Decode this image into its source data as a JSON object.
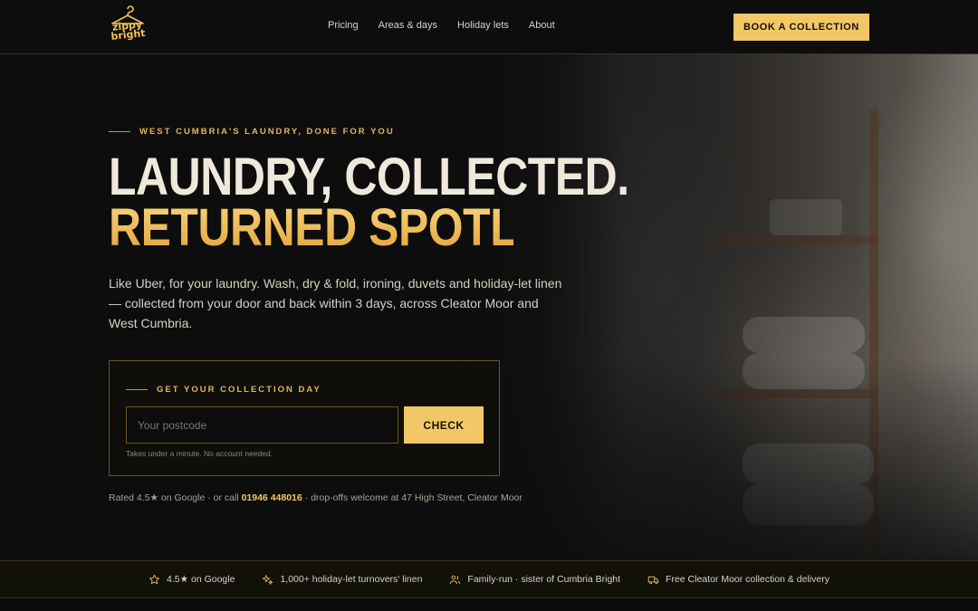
{
  "brand": {
    "logo_text": "zippy bright",
    "accent": "#f3c766",
    "background": "#0d0d0d"
  },
  "nav": {
    "items": [
      "Pricing",
      "Areas & days",
      "Holiday lets",
      "About"
    ]
  },
  "header": {
    "cta_label": "BOOK A COLLECTION"
  },
  "hero": {
    "eyebrow": "WEST CUMBRIA'S LAUNDRY, DONE FOR YOU",
    "headline_line1": "LAUNDRY, COLLECTED.",
    "headline_line2": "RETURNED SPOTLESS.",
    "lead": "Like Uber, for your laundry. Wash, dry & fold, ironing, duvets and holiday-let linen — collected from your door and back within 3 days, across Cleator Moor and West Cumbria."
  },
  "form": {
    "eyebrow": "GET YOUR COLLECTION DAY",
    "postcode_placeholder": "Your postcode",
    "postcode_value": "",
    "button_label": "CHECK",
    "hint": "Takes under a minute. No account needed."
  },
  "rated": {
    "prefix": "Rated 4.5★ on Google · or call ",
    "phone": "01946 448016",
    "suffix": " · drop-offs welcome at 47 High Street, Cleator Moor"
  },
  "trust_bar": {
    "items": [
      {
        "icon": "star-icon",
        "label": "4.5★ on Google"
      },
      {
        "icon": "sparkle-icon",
        "label": "1,000+ holiday-let turnovers' linen"
      },
      {
        "icon": "people-icon",
        "label": "Family-run · sister of Cumbria Bright"
      },
      {
        "icon": "truck-icon",
        "label": "Free Cleator Moor collection & delivery"
      }
    ]
  }
}
